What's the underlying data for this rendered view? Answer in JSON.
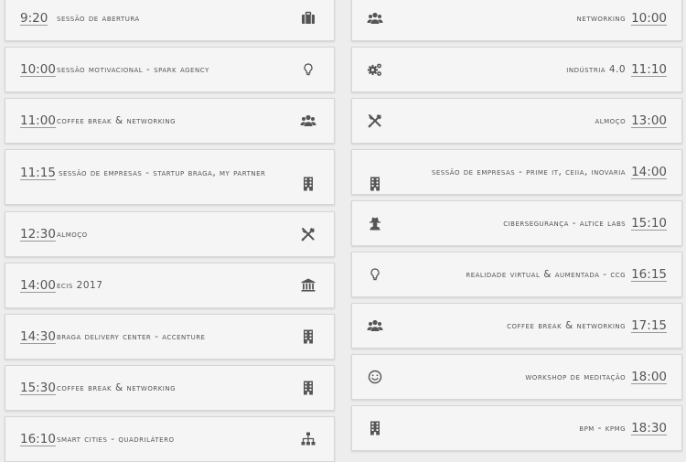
{
  "schedule": {
    "left": [
      {
        "time": "9:20",
        "title": "Sessão de abertura",
        "icon": "briefcase-icon"
      },
      {
        "time": "10:00",
        "title": "Sessão motivacional - Spark Agency",
        "icon": "lightbulb-icon"
      },
      {
        "time": "11:00",
        "title": "Coffee break & Networking",
        "icon": "users-icon"
      },
      {
        "time": "11:15",
        "title": "Sessão de empresas - Startup Braga, My Partner",
        "icon": "building-icon"
      },
      {
        "time": "12:30",
        "title": "Almoço",
        "icon": "cutlery-icon"
      },
      {
        "time": "14:00",
        "title": "ECIS 2017",
        "icon": "bank-icon"
      },
      {
        "time": "14:30",
        "title": "Braga Delivery Center - Accenture",
        "icon": "building-icon"
      },
      {
        "time": "15:30",
        "title": "Coffee break & Networking",
        "icon": "building-icon"
      },
      {
        "time": "16:10",
        "title": "Smart Cities - Quadrilátero",
        "icon": "sitemap-icon"
      }
    ],
    "right": [
      {
        "time": "10:00",
        "title": "Networking",
        "icon": "users-icon"
      },
      {
        "time": "11:10",
        "title": "Indústria 4.0",
        "icon": "cogs-icon"
      },
      {
        "time": "13:00",
        "title": "Almoço",
        "icon": "cutlery-icon"
      },
      {
        "time": "14:00",
        "title": "Sessão de empresas - Prime IT, CEiiA, Inovaria",
        "icon": "building-icon"
      },
      {
        "time": "15:10",
        "title": "Cibersegurança - Altice Labs",
        "icon": "user-secret-icon"
      },
      {
        "time": "16:15",
        "title": "Realidade Virtual & Aumentada - CCG",
        "icon": "lightbulb-icon"
      },
      {
        "time": "17:15",
        "title": "Coffee break & Networking",
        "icon": "users-icon"
      },
      {
        "time": "18:00",
        "title": "Workshop de Meditação",
        "icon": "smile-icon"
      },
      {
        "time": "18:30",
        "title": "BPM - KPMG",
        "icon": "building-icon"
      }
    ]
  },
  "colors": {
    "text": "#555555",
    "card": "#f5f5f5",
    "background": "#ededed"
  }
}
